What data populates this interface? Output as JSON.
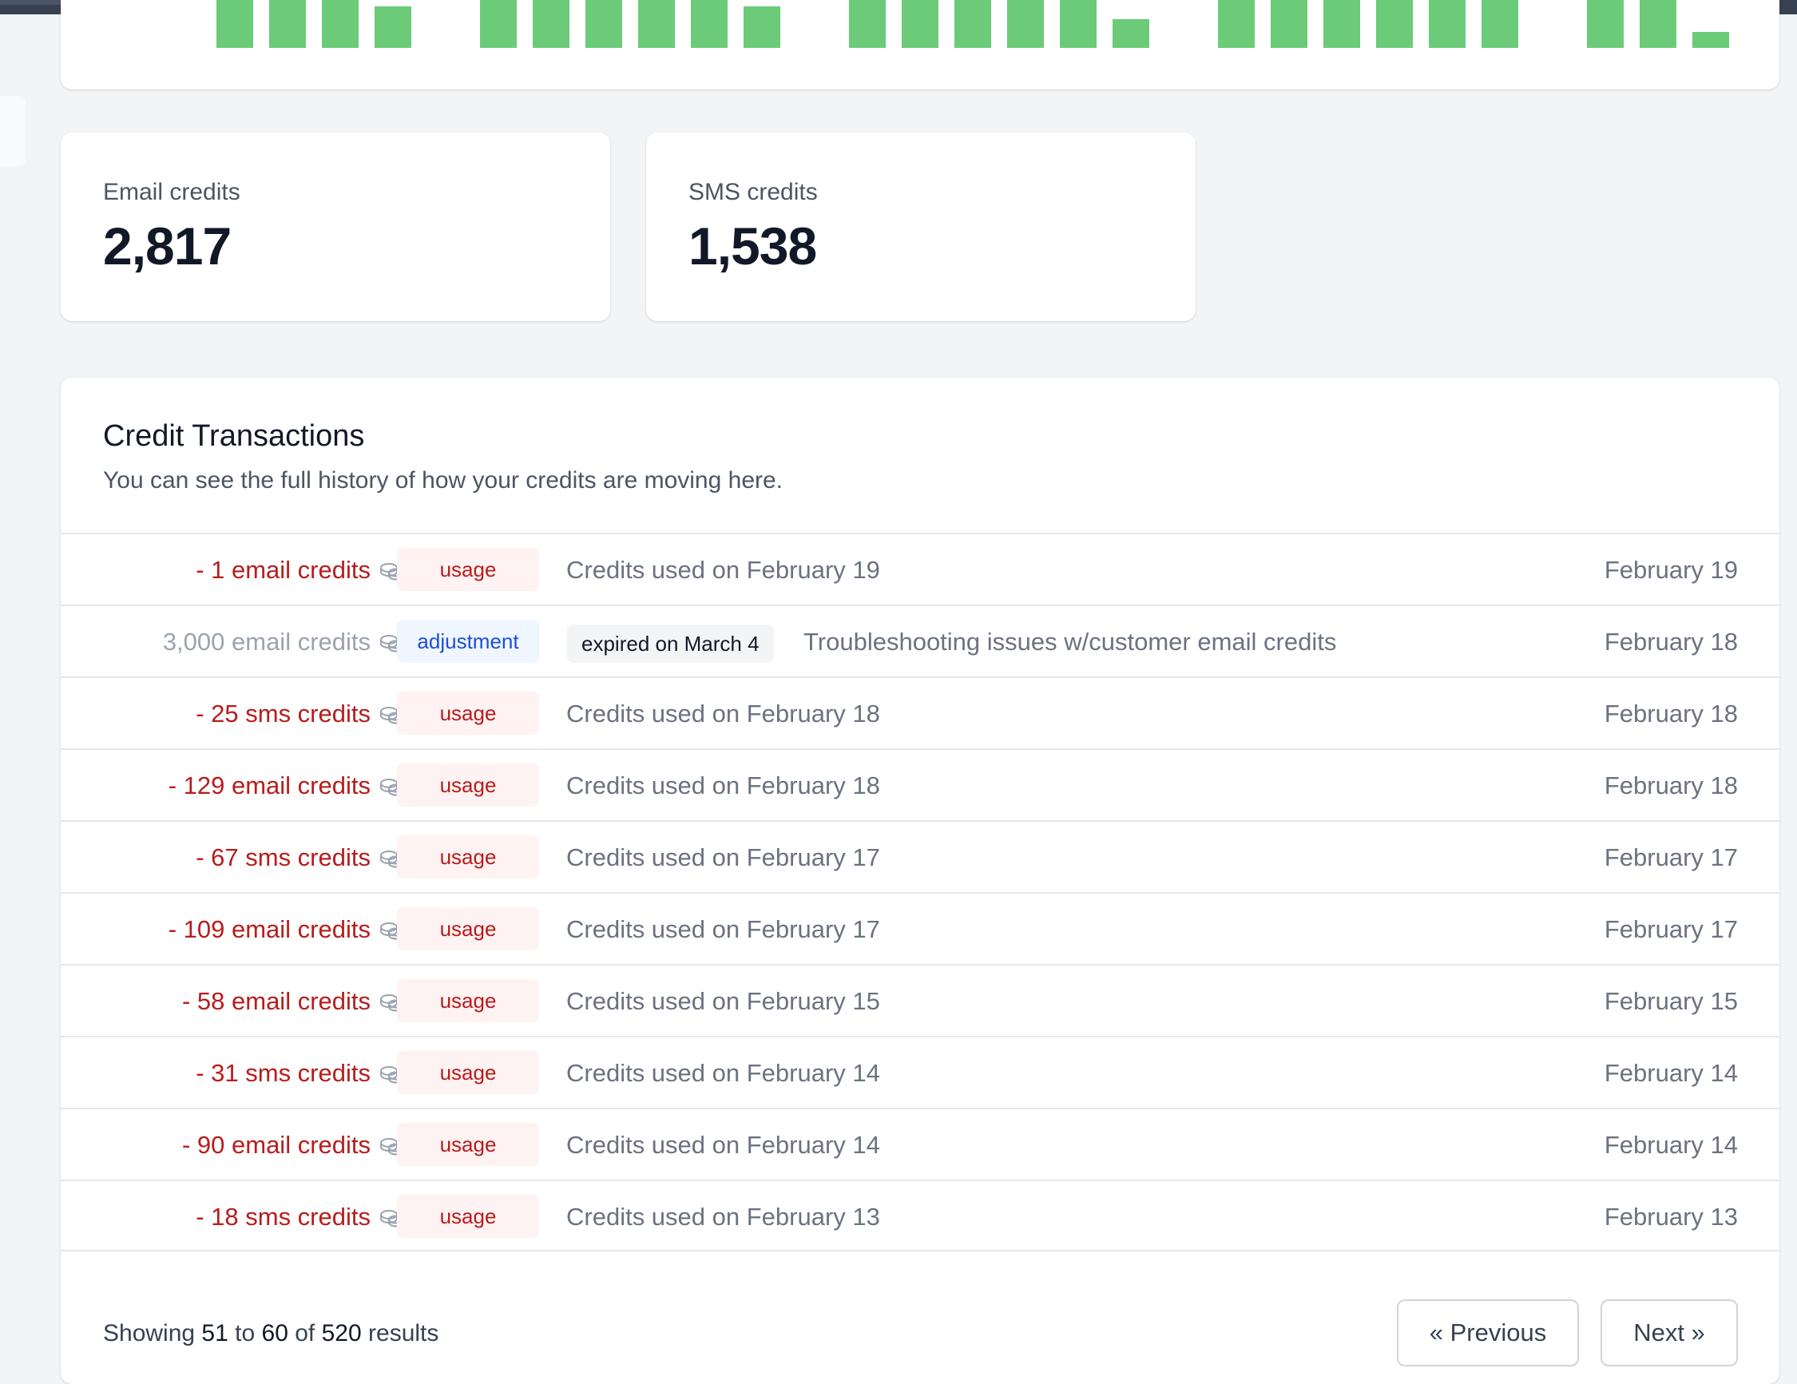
{
  "colors": {
    "bar": "#6ccb78",
    "negative": "#b91c1c",
    "usage_bg": "#fef2f2",
    "adjustment_bg": "#eff6ff",
    "adjustment_fg": "#1d4ed8"
  },
  "stats": {
    "email": {
      "label": "Email credits",
      "value": "2,817"
    },
    "sms": {
      "label": "SMS credits",
      "value": "1,538"
    }
  },
  "usage_chart": {
    "bars": [
      1,
      1,
      1,
      0.65,
      0,
      1,
      1,
      1,
      1,
      1,
      0.65,
      0,
      1,
      1,
      1,
      1,
      1,
      0.45,
      0,
      1,
      1,
      1,
      1,
      1,
      1,
      0,
      1,
      1,
      0.25
    ]
  },
  "transactions": {
    "title": "Credit Transactions",
    "subtitle": "You can see the full history of how your credits are moving here.",
    "rows": [
      {
        "amount": "- 1 email credits",
        "negative": true,
        "type": "usage",
        "expired": "",
        "description": "Credits used on February 19",
        "date": "February 19"
      },
      {
        "amount": "3,000 email credits",
        "negative": false,
        "type": "adjustment",
        "expired": "expired on March 4",
        "description": "Troubleshooting issues w/customer email credits",
        "date": "February 18"
      },
      {
        "amount": "- 25 sms credits",
        "negative": true,
        "type": "usage",
        "expired": "",
        "description": "Credits used on February 18",
        "date": "February 18"
      },
      {
        "amount": "- 129 email credits",
        "negative": true,
        "type": "usage",
        "expired": "",
        "description": "Credits used on February 18",
        "date": "February 18"
      },
      {
        "amount": "- 67 sms credits",
        "negative": true,
        "type": "usage",
        "expired": "",
        "description": "Credits used on February 17",
        "date": "February 17"
      },
      {
        "amount": "- 109 email credits",
        "negative": true,
        "type": "usage",
        "expired": "",
        "description": "Credits used on February 17",
        "date": "February 17"
      },
      {
        "amount": "- 58 email credits",
        "negative": true,
        "type": "usage",
        "expired": "",
        "description": "Credits used on February 15",
        "date": "February 15"
      },
      {
        "amount": "- 31 sms credits",
        "negative": true,
        "type": "usage",
        "expired": "",
        "description": "Credits used on February 14",
        "date": "February 14"
      },
      {
        "amount": "- 90 email credits",
        "negative": true,
        "type": "usage",
        "expired": "",
        "description": "Credits used on February 14",
        "date": "February 14"
      },
      {
        "amount": "- 18 sms credits",
        "negative": true,
        "type": "usage",
        "expired": "",
        "description": "Credits used on February 13",
        "date": "February 13"
      }
    ],
    "row_icon": "coins-icon"
  },
  "pagination": {
    "showing_prefix": "Showing",
    "from": "51",
    "to_word": "to",
    "to": "60",
    "of_word": "of",
    "total": "520",
    "results_word": "results",
    "previous_label": "« Previous",
    "next_label": "Next »"
  }
}
